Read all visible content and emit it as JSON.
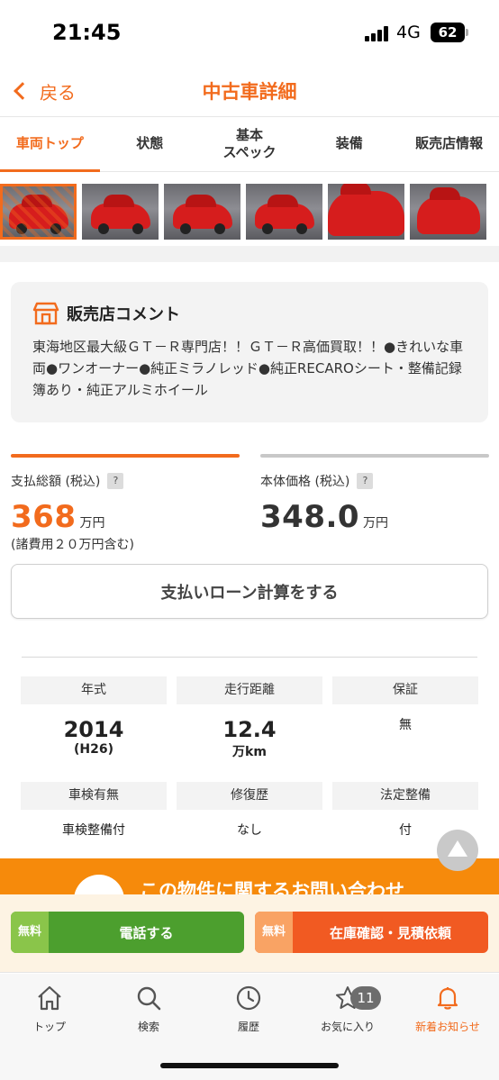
{
  "status_bar": {
    "time": "21:45",
    "network": "4G",
    "battery": "62"
  },
  "header": {
    "back_label": "戻る",
    "title": "中古車詳細"
  },
  "tabs": [
    {
      "label": "車両トップ",
      "active": true
    },
    {
      "label": "状態"
    },
    {
      "label": "基本\nスペック"
    },
    {
      "label": "装備"
    },
    {
      "label": "販売店情報"
    }
  ],
  "gallery": {
    "thumbnail_count": 6,
    "selected_index": 0
  },
  "dealer_comment": {
    "title": "販売店コメント",
    "body": "東海地区最大級ＧＴ－Ｒ専門店！！ＧＴ－Ｒ高価買取！！●きれいな車両●ワンオーナー●純正ミラノレッド●純正RECAROシート・整備記録簿あり・純正アルミホイール"
  },
  "pricing": {
    "total": {
      "label": "支払総額 (税込)",
      "help": "?",
      "value": "368",
      "unit": "万円",
      "note": "(諸費用２０万円含む)"
    },
    "body_price": {
      "label": "本体価格 (税込)",
      "help": "?",
      "value": "348.0",
      "unit": "万円"
    },
    "loan_button": "支払いローン計算をする"
  },
  "specs": [
    {
      "label": "年式",
      "value": "2014",
      "sub": "(H26)"
    },
    {
      "label": "走行距離",
      "value": "12.4",
      "sub": "万km"
    },
    {
      "label": "保証",
      "value": "無"
    },
    {
      "label": "車検有無",
      "value": "車検整備付"
    },
    {
      "label": "修復歴",
      "value": "なし"
    },
    {
      "label": "法定整備",
      "value": "付"
    }
  ],
  "inquiry_banner": "この物件に関するお問い合わせ",
  "actions": {
    "phone": {
      "free_tag": "無料",
      "label": "電話する"
    },
    "stock": {
      "free_tag": "無料",
      "label": "在庫確認・見積依頼"
    }
  },
  "tab_bar": {
    "items": [
      {
        "label": "トップ",
        "icon": "home-icon"
      },
      {
        "label": "検索",
        "icon": "search-icon"
      },
      {
        "label": "履歴",
        "icon": "clock-icon"
      },
      {
        "label": "お気に入り",
        "icon": "star-icon",
        "badge": "11"
      },
      {
        "label": "新着お知らせ",
        "icon": "bell-icon",
        "active": true
      }
    ]
  },
  "colors": {
    "accent": "#f26b1d",
    "phone_green": "#4c9f2e",
    "stock_orange": "#f15a22",
    "banner_orange": "#f68a0b"
  }
}
